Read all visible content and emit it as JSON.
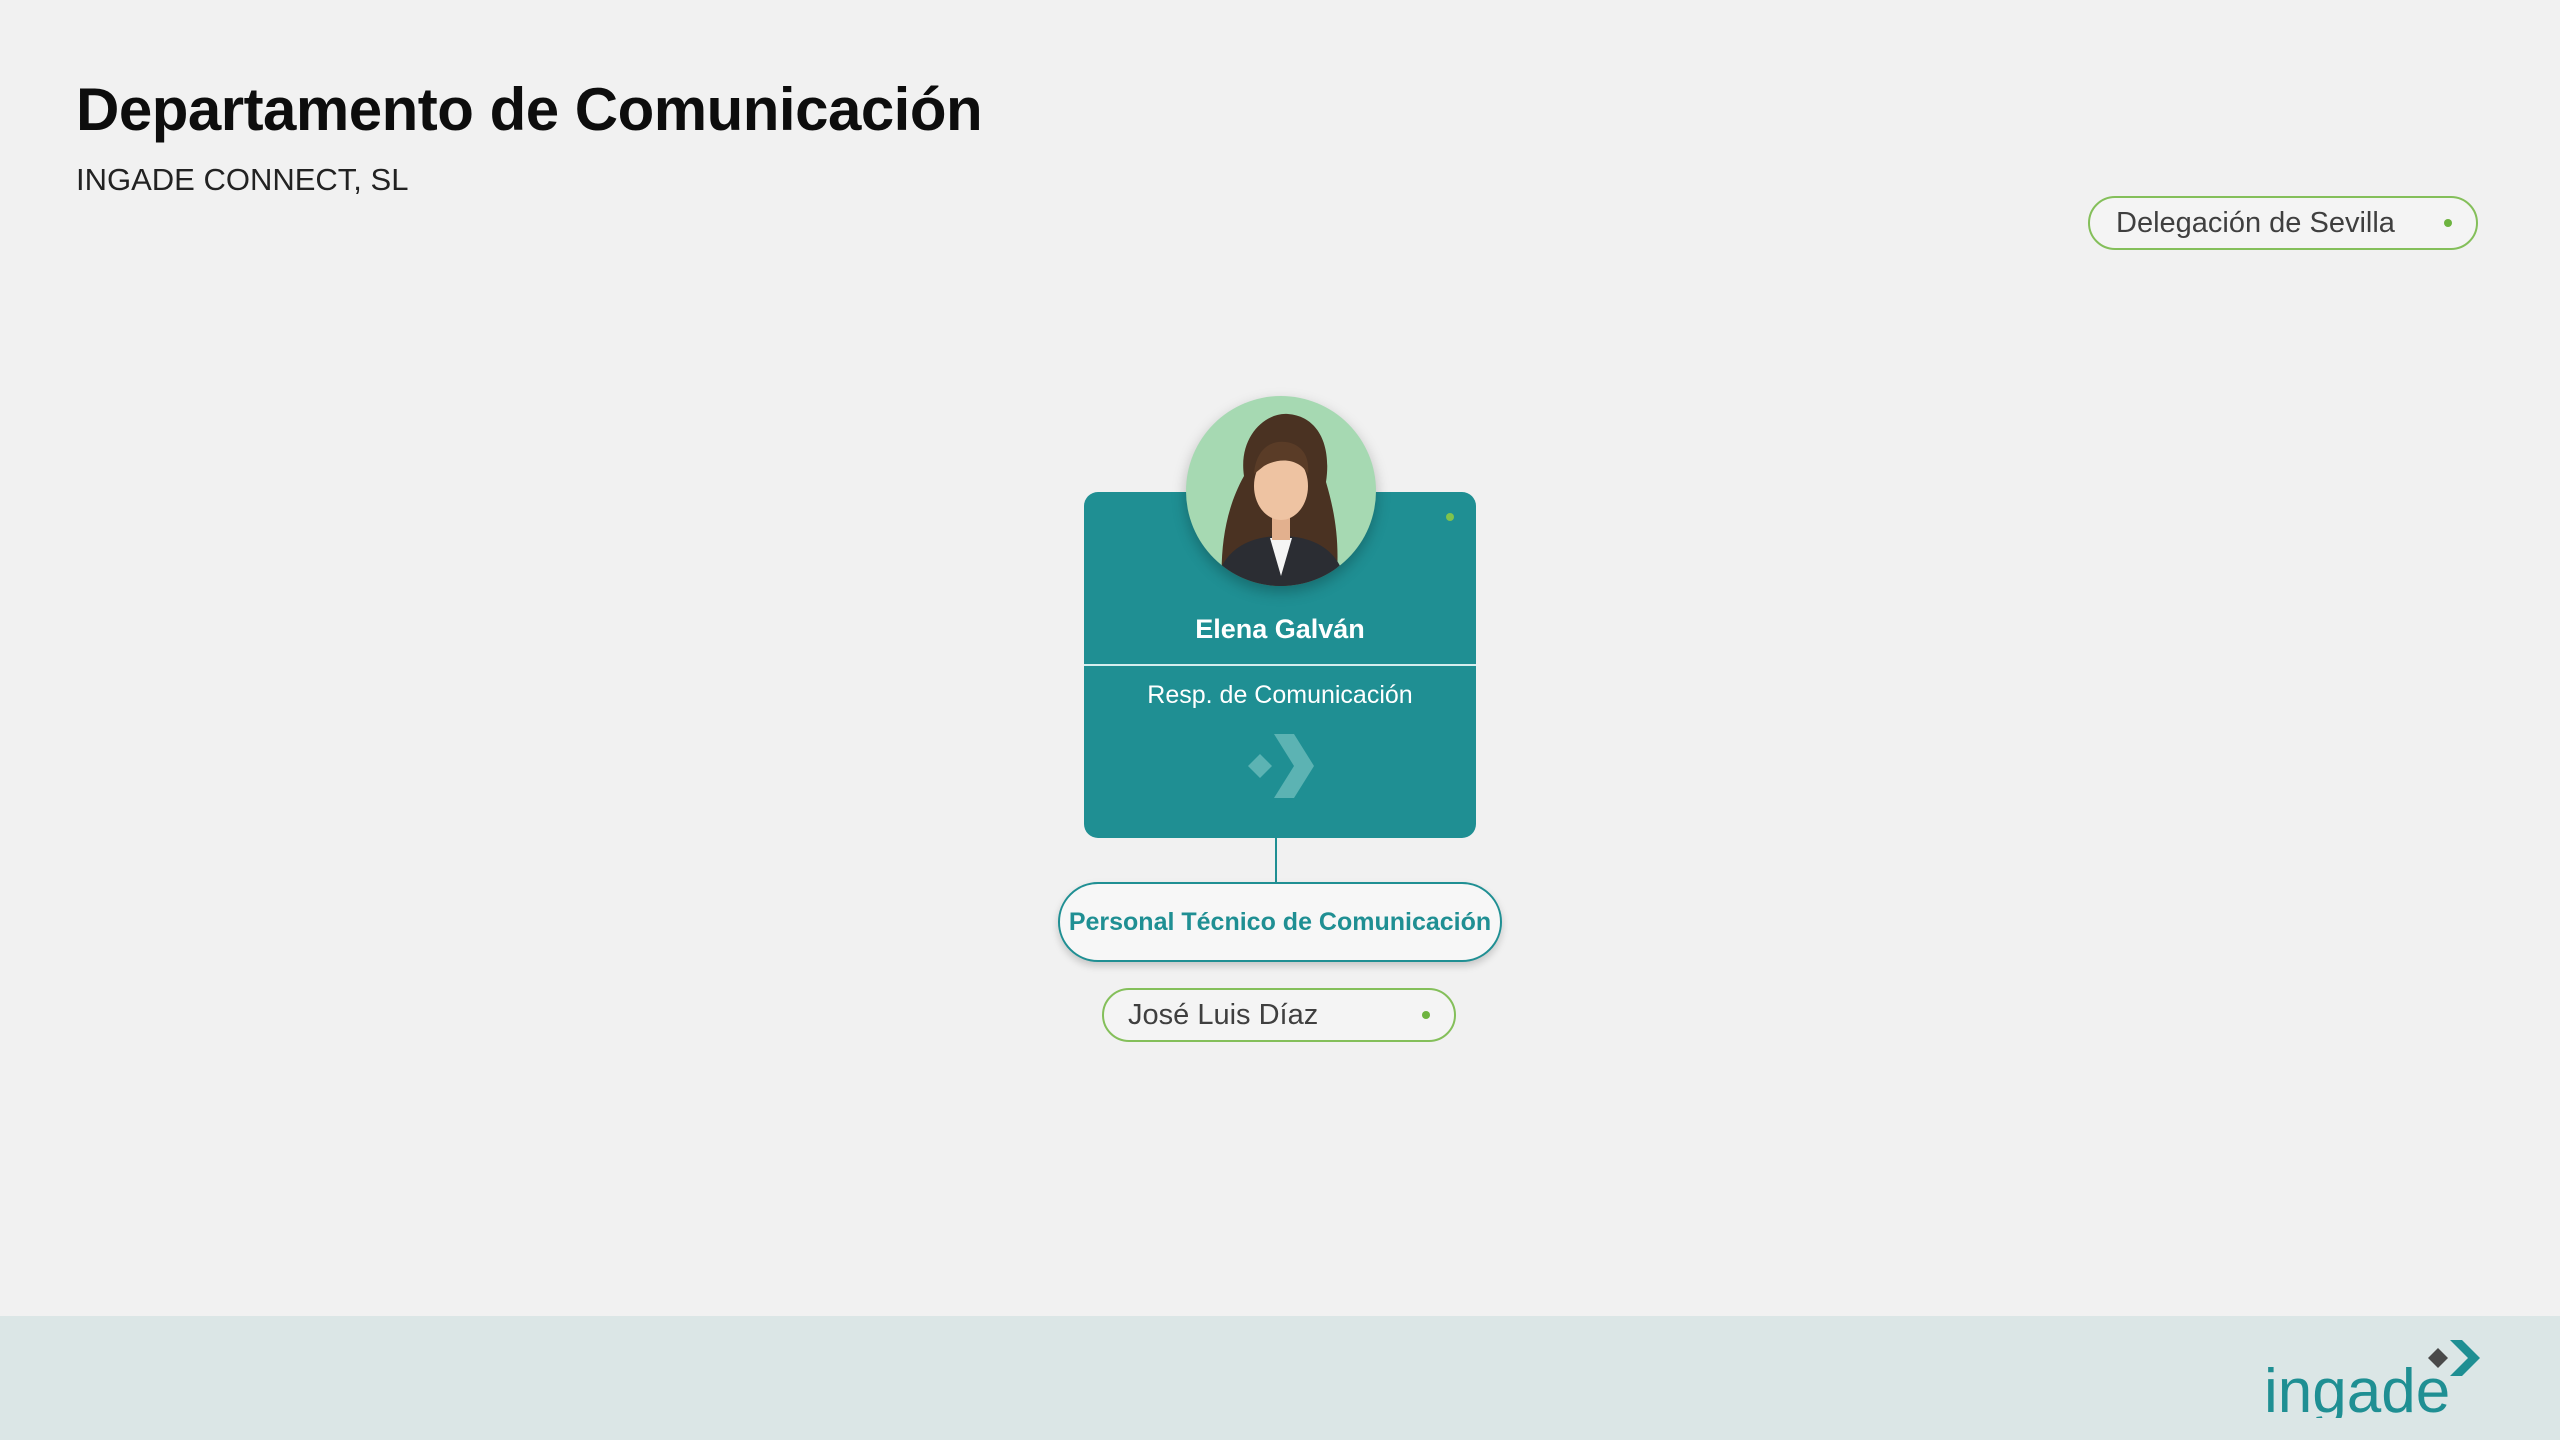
{
  "header": {
    "title": "Departamento de Comunicación",
    "company": "INGADE CONNECT, SL"
  },
  "location": {
    "label": "Delegación de Sevilla"
  },
  "manager": {
    "name": "Elena Galván",
    "role": "Resp. de Comunicación"
  },
  "team": {
    "label": "Personal Técnico de Comunicación",
    "members": [
      "José Luis Díaz"
    ]
  },
  "brand": {
    "name": "ingade",
    "primary_color": "#1f8f93",
    "accent_color": "#84bf5a",
    "logo_icon": "ingade-logo-icon"
  }
}
